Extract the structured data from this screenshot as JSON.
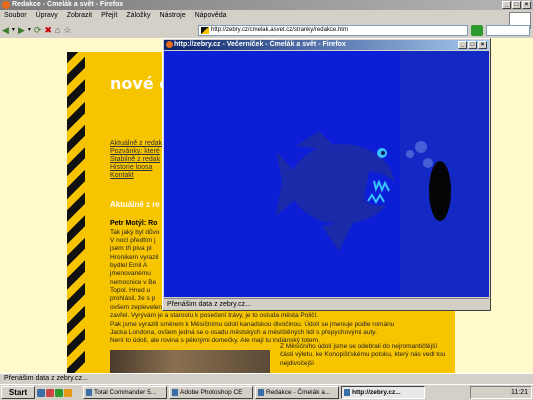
{
  "browser": {
    "title": "Redakce - Čmelák a svět - Firefox",
    "menu": [
      "Soubor",
      "Úpravy",
      "Zobrazit",
      "Přejít",
      "Záložky",
      "Nástroje",
      "Nápověda"
    ],
    "url": "http://zebry.cz/cmelak.asvet.cz/stranky/redakce.htm",
    "status": "Přenášim data z zebry.cz..."
  },
  "page": {
    "headline": "nové čísl",
    "links": [
      "Aktuálně z redak",
      "Pozvánky: které",
      "Stabilně z redak",
      "Historie loosa",
      "Kontakt"
    ],
    "section_heading": "Aktuálně z re",
    "author": "Petr Motýl: Ro",
    "paragraphs": [
      "Tak jaký byl důvo",
      "V nocí předtím j",
      "jsem tři piva pl",
      "Hroníkem vyrazil",
      "bydlel Emil A",
      "jmenovanému",
      "nemocnice v Be",
      "Topol. Hned u",
      "prohlásil, že s p",
      "ovšem zeplevelený, zanedbaný, ale ulice jsou nové a zarostlý travou do výšky poloviny lýtka, ale také",
      "zavřel. Vyrývám je a starostu k posečení trávy, je to ostuda města Poličí.",
      "Pak jsme vyrazili směrem k Měsíčnímu údolí kanadskou divočinou. Údolí se jmenuje podle románu",
      "Jacka Londona, ovšem jedná se o osadu městských a městštěných lidí s přepychovými auty.",
      "Není to údolí, ale rovina s pěknými domečky. Ale mají tu indiánský totem."
    ],
    "photo_caption": "Z Měsíčního údolí jsme se odebrali do nejromantičtější části výletu, ke Konopišťskému potoku, který nás vedl tou nejdivočejší"
  },
  "popup": {
    "title": "http://zebry.cz - Večerníček - Čmelák a svět - Firefox",
    "status": "Přenášim data z zebry.cz..."
  },
  "taskbar": {
    "start_label": "Start",
    "tasks": [
      "Total Commander 5...",
      "Adobe Photoshop CE",
      "Redakce - Čmelák a...",
      "http://zebry.cz..."
    ],
    "clock": "11:21"
  },
  "colors": {
    "page_bg": "#fff9cc",
    "panel_yellow": "#f7c400",
    "popup_blue": "#0c1fd6",
    "fish": "#1a2aa8",
    "fish_eye": "#39c2ff",
    "portal": "#050505"
  }
}
